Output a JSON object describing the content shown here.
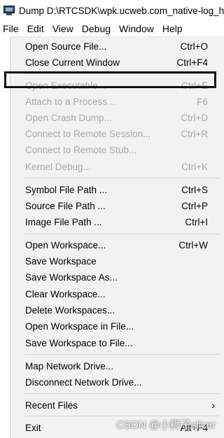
{
  "window": {
    "title": "Dump D:\\RTCSDK\\wpk.ucweb.com_native-log_hl"
  },
  "menubar": [
    "File",
    "Edit",
    "View",
    "Debug",
    "Window",
    "Help"
  ],
  "file_menu": {
    "open_source_file": {
      "label": "Open Source File...",
      "shortcut": "Ctrl+O"
    },
    "close_current_window": {
      "label": "Close Current Window",
      "shortcut": "Ctrl+F4"
    },
    "open_executable": {
      "label": "Open Executable...",
      "shortcut": "Ctrl+E"
    },
    "attach_to_process": {
      "label": "Attach to a Process...",
      "shortcut": "F6"
    },
    "open_crash_dump": {
      "label": "Open Crash Dump...",
      "shortcut": "Ctrl+D"
    },
    "connect_remote_session": {
      "label": "Connect to Remote Session...",
      "shortcut": "Ctrl+R"
    },
    "connect_remote_stub": {
      "label": "Connect to Remote Stub..."
    },
    "kernel_debug": {
      "label": "Kernel Debug...",
      "shortcut": "Ctrl+K"
    },
    "symbol_file_path": {
      "label": "Symbol File Path ...",
      "shortcut": "Ctrl+S"
    },
    "source_file_path": {
      "label": "Source File Path ...",
      "shortcut": "Ctrl+P"
    },
    "image_file_path": {
      "label": "Image File Path ...",
      "shortcut": "Ctrl+I"
    },
    "open_workspace": {
      "label": "Open Workspace...",
      "shortcut": "Ctrl+W"
    },
    "save_workspace": {
      "label": "Save Workspace"
    },
    "save_workspace_as": {
      "label": "Save Workspace As..."
    },
    "clear_workspace": {
      "label": "Clear Workspace..."
    },
    "delete_workspaces": {
      "label": "Delete Workspaces..."
    },
    "open_workspace_in_file": {
      "label": "Open Workspace in File..."
    },
    "save_workspace_to_file": {
      "label": "Save Workspace to File..."
    },
    "map_network_drive": {
      "label": "Map Network Drive..."
    },
    "disconnect_network_drive": {
      "label": "Disconnect Network Drive..."
    },
    "recent_files": {
      "label": "Recent Files",
      "arrow": "›"
    },
    "exit": {
      "label": "Exit",
      "shortcut": "Alt+F4"
    }
  },
  "watermark": "CSDN @小狮子slicer"
}
